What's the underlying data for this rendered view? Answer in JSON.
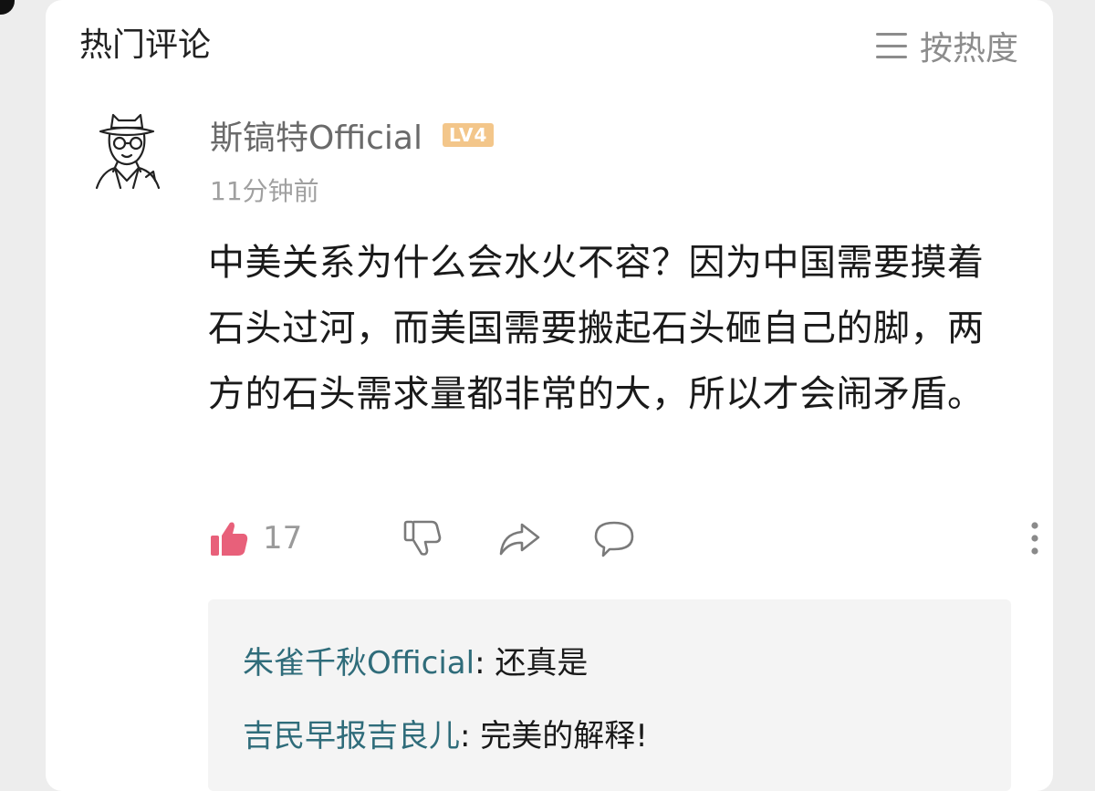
{
  "header": {
    "title": "热门评论",
    "sort_label": "按热度"
  },
  "comment": {
    "username": "斯镐特Official",
    "level": "LV4",
    "time": "11分钟前",
    "text": "中美关系为什么会水火不容？因为中国需要摸着石头过河，而美国需要搬起石头砸自己的脚，两方的石头需求量都非常的大，所以才会闹矛盾。",
    "like_count": "17"
  },
  "replies": [
    {
      "name": "朱雀千秋Official",
      "sep": ": ",
      "text": "还真是"
    },
    {
      "name": "吉民早报吉良儿",
      "sep": ": ",
      "text": "完美的解释!"
    }
  ],
  "icons": {
    "sort": "menu-lines-icon",
    "like": "thumbs-up-icon",
    "dislike": "thumbs-down-icon",
    "share": "share-arrow-icon",
    "reply": "speech-bubble-icon",
    "more": "more-vertical-icon"
  },
  "colors": {
    "like_active": "#e8607a",
    "reply_name": "#2f6c7a",
    "level_badge": "#f3c68a"
  }
}
